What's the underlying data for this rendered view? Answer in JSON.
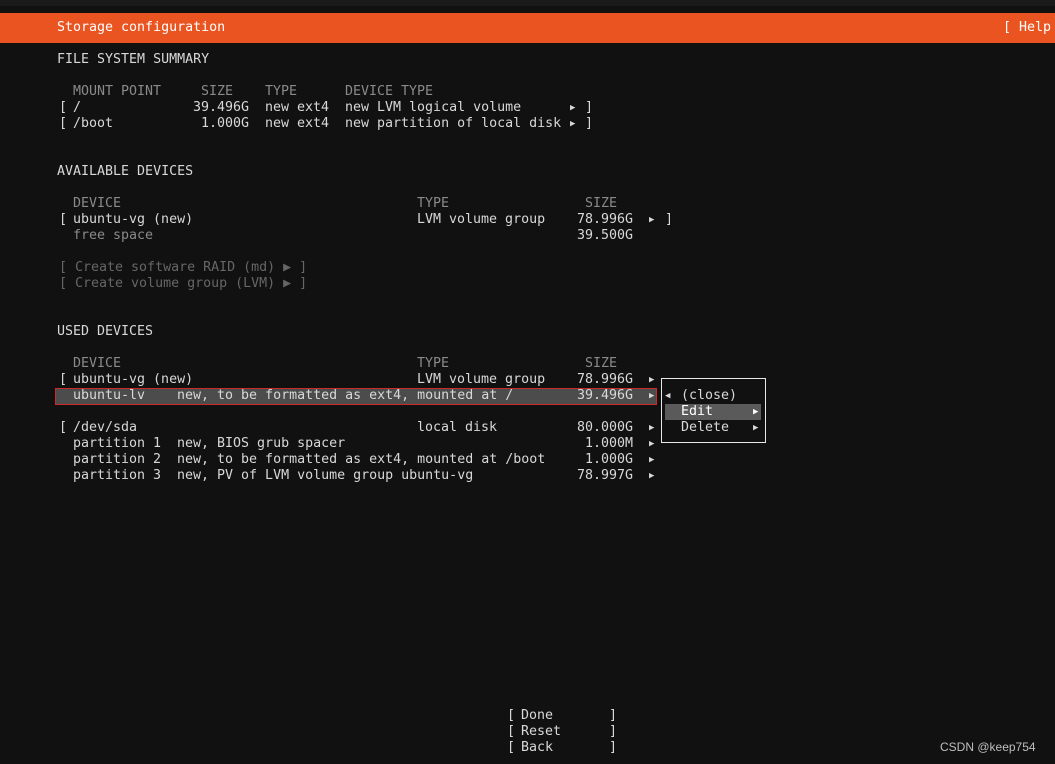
{
  "header": {
    "title": "Storage configuration",
    "help": "[ Help"
  },
  "fs_summary": {
    "heading": "FILE SYSTEM SUMMARY",
    "col_mount": "MOUNT POINT",
    "col_size": "SIZE",
    "col_type": "TYPE",
    "col_devtype": "DEVICE TYPE",
    "rows": [
      {
        "mount": "/",
        "size": "39.496G",
        "type": "new ext4",
        "devtype": "new LVM logical volume"
      },
      {
        "mount": "/boot",
        "size": "1.000G",
        "type": "new ext4",
        "devtype": "new partition of local disk"
      }
    ]
  },
  "available": {
    "heading": "AVAILABLE DEVICES",
    "col_device": "DEVICE",
    "col_type": "TYPE",
    "col_size": "SIZE",
    "vg_name": "ubuntu-vg (new)",
    "vg_type": "LVM volume group",
    "vg_size": "78.996G",
    "free_label": "free space",
    "free_size": "39.500G",
    "create_raid": "[ Create software RAID (md) ▶ ]",
    "create_vg": "[ Create volume group (LVM) ▶ ]"
  },
  "used": {
    "heading": "USED DEVICES",
    "col_device": "DEVICE",
    "col_type": "TYPE",
    "col_size": "SIZE",
    "vg_name": "ubuntu-vg (new)",
    "vg_type": "LVM volume group",
    "vg_size": "78.996G",
    "lv_name": "ubuntu-lv",
    "lv_desc": "new, to be formatted as ext4, mounted at /",
    "lv_size": "39.496G",
    "disk_name": "/dev/sda",
    "disk_type": "local disk",
    "disk_size": "80.000G",
    "partitions": [
      {
        "name": "partition 1",
        "desc": "new, BIOS grub spacer",
        "size": "1.000M"
      },
      {
        "name": "partition 2",
        "desc": "new, to be formatted as ext4, mounted at /boot",
        "size": "1.000G"
      },
      {
        "name": "partition 3",
        "desc": "new, PV of LVM volume group ubuntu-vg",
        "size": "78.997G"
      }
    ]
  },
  "context_menu": {
    "close": "(close)",
    "edit": "Edit",
    "delete": "Delete"
  },
  "buttons": {
    "done": "Done",
    "reset": "Reset",
    "back": "Back"
  },
  "watermark": "CSDN @keep754"
}
